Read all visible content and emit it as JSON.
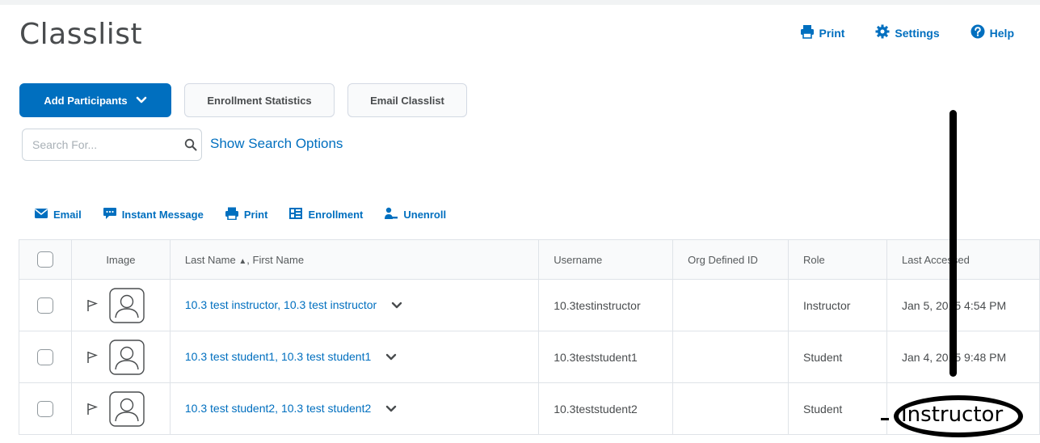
{
  "page": {
    "title": "Classlist"
  },
  "top_links": {
    "print": "Print",
    "settings": "Settings",
    "help": "Help"
  },
  "buttons": {
    "add_participants": "Add Participants",
    "enrollment_statistics": "Enrollment Statistics",
    "email_classlist": "Email Classlist"
  },
  "search": {
    "placeholder": "Search For...",
    "value": "",
    "show_options": "Show Search Options"
  },
  "actions": {
    "email": "Email",
    "instant_message": "Instant Message",
    "print": "Print",
    "enrollment": "Enrollment",
    "unenroll": "Unenroll"
  },
  "table": {
    "headers": {
      "image": "Image",
      "name": "Last Name",
      "name_rest": ", First Name",
      "username": "Username",
      "org_id": "Org Defined ID",
      "role": "Role",
      "last_accessed": "Last Accessed"
    },
    "rows": [
      {
        "name": "10.3 test instructor, 10.3 test instructor",
        "username": "10.3testinstructor",
        "org_id": "",
        "role": "Instructor",
        "last_accessed": "Jan 5, 2015 4:54 PM"
      },
      {
        "name": "10.3 test student1, 10.3 test student1",
        "username": "10.3teststudent1",
        "org_id": "",
        "role": "Student",
        "last_accessed": "Jan 4, 2015 9:48 PM"
      },
      {
        "name": "10.3 test student2, 10.3 test student2",
        "username": "10.3teststudent2",
        "org_id": "",
        "role": "Student",
        "last_accessed": ""
      }
    ]
  },
  "annotation": {
    "text": "Instructor"
  },
  "colors": {
    "accent": "#006fbf",
    "text": "#494c4e",
    "border": "#dfe3e8"
  }
}
